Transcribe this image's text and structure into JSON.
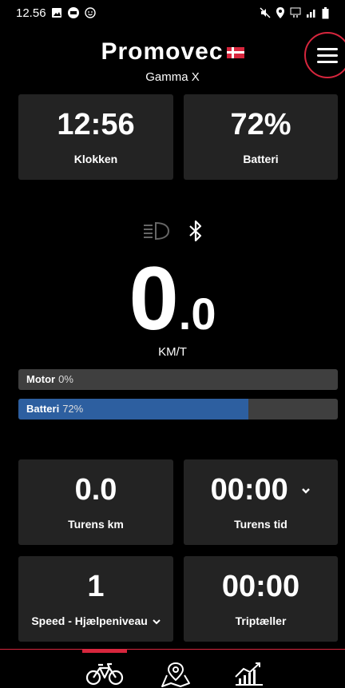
{
  "status": {
    "time": "12.56",
    "left_icons": [
      "image-icon",
      "messenger-icon",
      "smiley-icon"
    ],
    "right_icons": [
      "mute-icon",
      "location-icon",
      "data-icon",
      "signal-icon",
      "battery-icon"
    ]
  },
  "header": {
    "logo": "Promovec",
    "model": "Gamma X"
  },
  "tiles_top": {
    "clock_value": "12:56",
    "clock_label": "Klokken",
    "battery_value": "72%",
    "battery_label": "Batteri"
  },
  "center": {
    "speed_int": "0",
    "speed_dec": ".0",
    "unit": "KM/T",
    "headlight": "headlight-icon",
    "bluetooth": "bluetooth-icon"
  },
  "bars": {
    "motor_label": "Motor",
    "motor_value": "0%",
    "motor_fraction": 0,
    "battery_label": "Batteri",
    "battery_value": "72%",
    "battery_fraction": 0.72
  },
  "tiles_bottom": {
    "trip_km_value": "0.0",
    "trip_km_label": "Turens km",
    "trip_time_value": "00:00",
    "trip_time_label": "Turens tid",
    "assist_value": "1",
    "assist_label": "Speed - Hjælpeniveau",
    "tripcounter_value": "00:00",
    "tripcounter_label": "Triptæller"
  },
  "nav": {
    "items": [
      "bike-icon",
      "map-icon",
      "stats-icon"
    ],
    "active_index": 0
  },
  "colors": {
    "accent": "#d7263d",
    "battery_fill": "#2d5fa0",
    "tile_bg": "#232323"
  }
}
